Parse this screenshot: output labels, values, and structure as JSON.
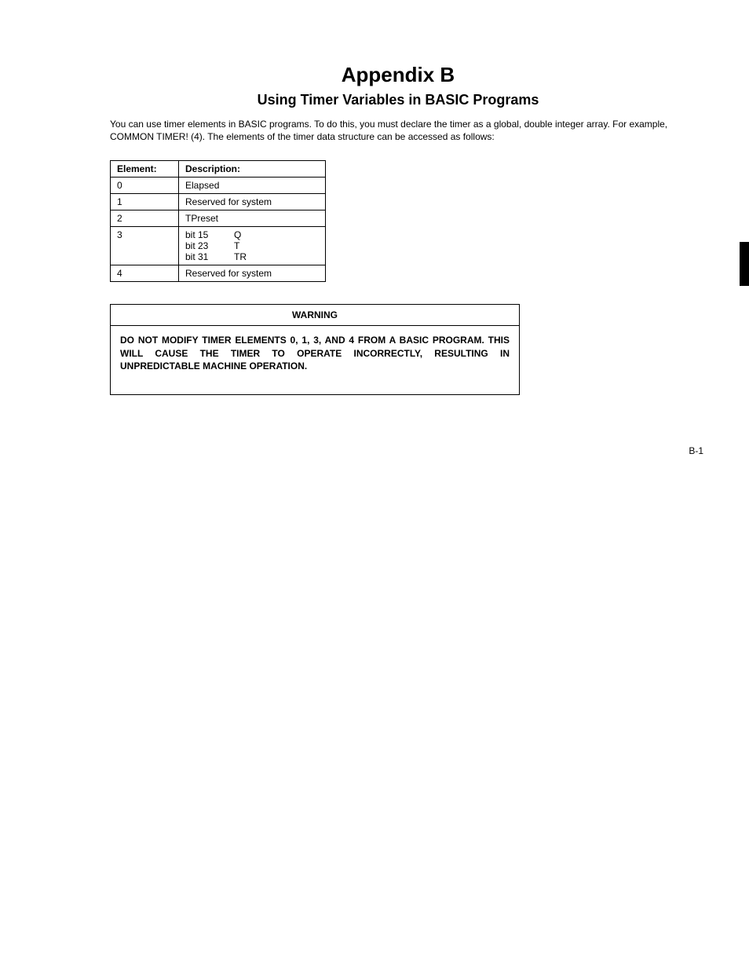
{
  "title": "Appendix B",
  "subtitle": "Using Timer Variables in BASIC Programs",
  "intro": "You can use timer elements in BASIC programs. To do this, you must declare the timer as a global, double integer array. For example, COMMON TIMER! (4). The elements of the timer data structure can be accessed as follows:",
  "table": {
    "headers": {
      "element": "Element:",
      "description": "Description:"
    },
    "rows": [
      {
        "element": "0",
        "description": "Elapsed"
      },
      {
        "element": "1",
        "description": "Reserved for system"
      },
      {
        "element": "2",
        "description": "TPreset"
      },
      {
        "element": "3",
        "bits": [
          {
            "bit": "bit 15",
            "val": "Q"
          },
          {
            "bit": "bit 23",
            "val": "T"
          },
          {
            "bit": "bit 31",
            "val": "TR"
          }
        ]
      },
      {
        "element": "4",
        "description": "Reserved for system"
      }
    ]
  },
  "warning": {
    "heading": "WARNING",
    "body": "DO NOT MODIFY TIMER ELEMENTS 0, 1, 3, AND 4 FROM A BASIC PROGRAM. THIS WILL CAUSE THE TIMER TO OPERATE INCORRECTLY, RESULTING IN UNPREDICTABLE MACHINE OPERATION."
  },
  "page_number": "B-1"
}
